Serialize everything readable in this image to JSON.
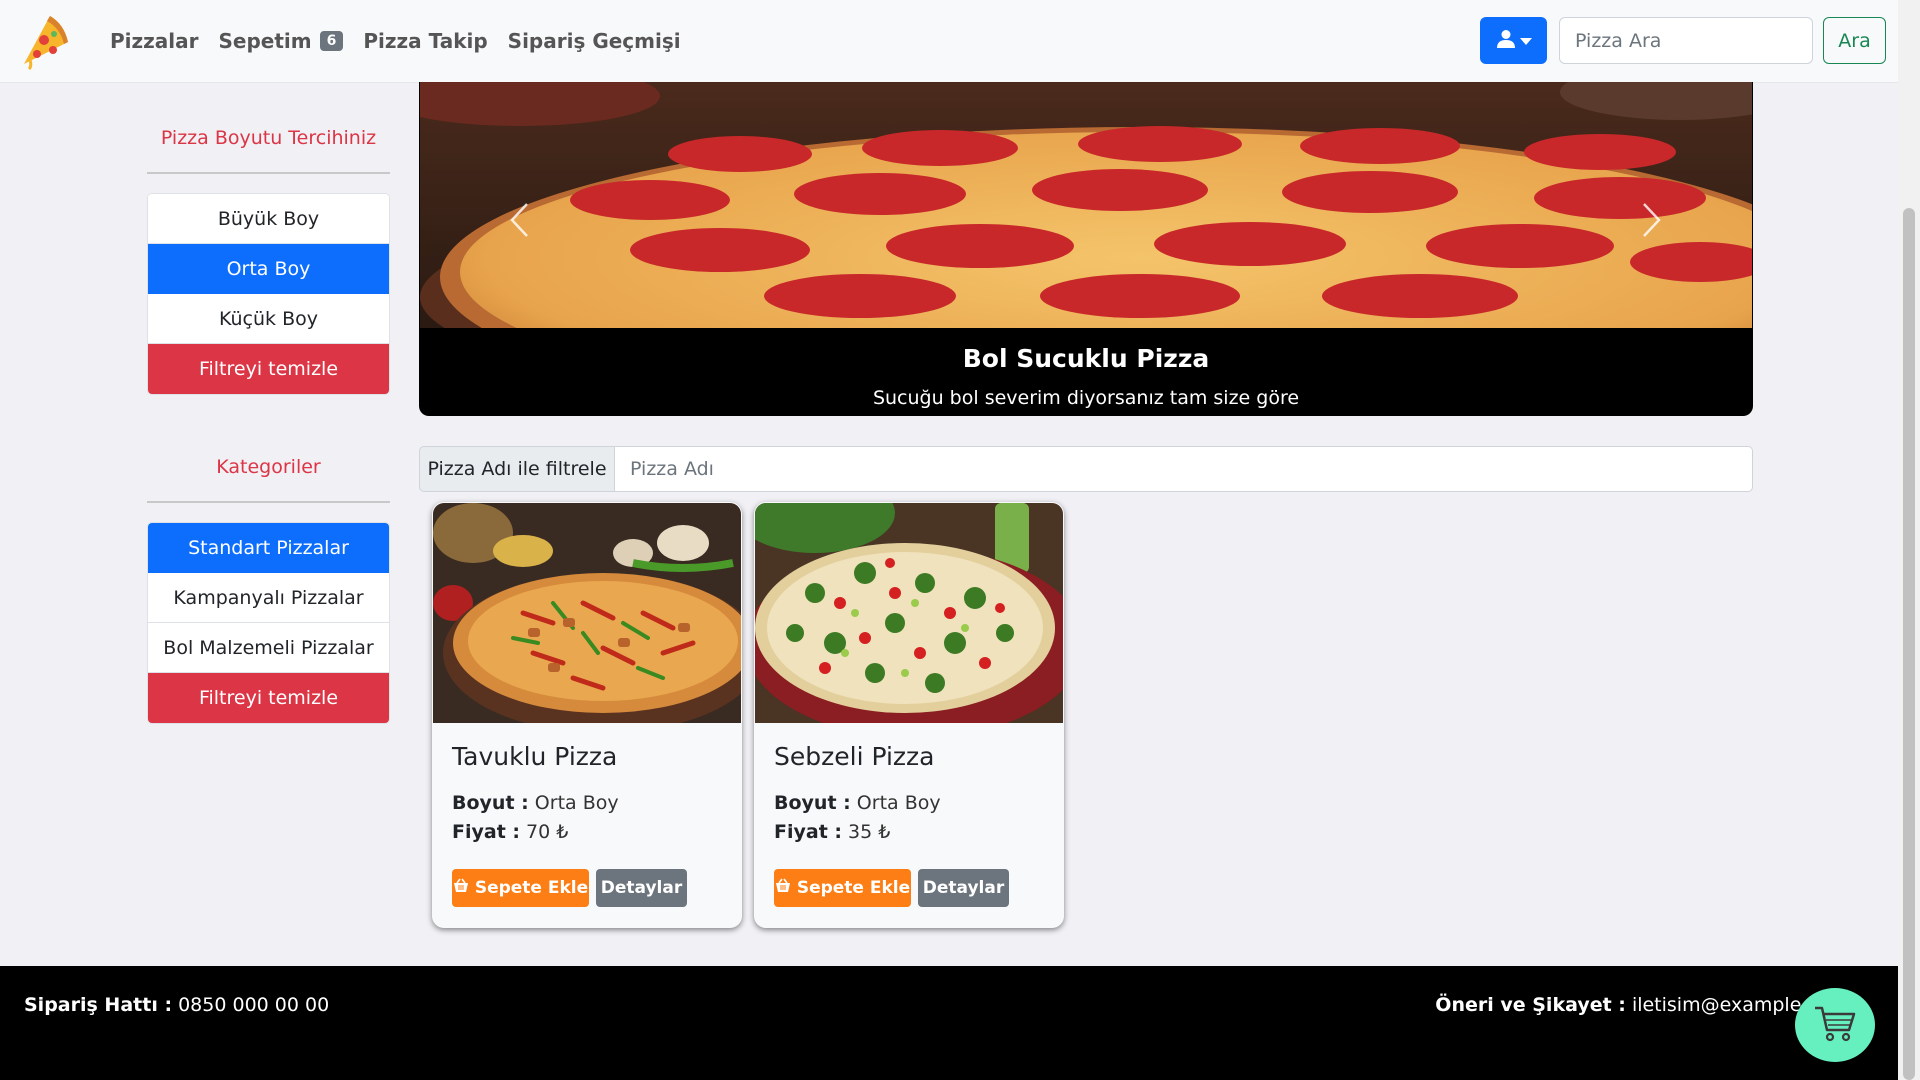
{
  "navbar": {
    "links": [
      {
        "label": "Pizzalar"
      },
      {
        "label": "Sepetim",
        "badge": "6"
      },
      {
        "label": "Pizza Takip"
      },
      {
        "label": "Sipariş Geçmişi"
      }
    ],
    "search_placeholder": "Pizza Ara",
    "search_button": "Ara"
  },
  "sidebar": {
    "size_heading": "Pizza Boyutu Tercihiniz",
    "sizes": [
      {
        "label": "Büyük Boy",
        "active": false
      },
      {
        "label": "Orta Boy",
        "active": true
      },
      {
        "label": "Küçük Boy",
        "active": false
      }
    ],
    "size_clear": "Filtreyi temizle",
    "category_heading": "Kategoriler",
    "categories": [
      {
        "label": "Standart Pizzalar",
        "active": true
      },
      {
        "label": "Kampanyalı Pizzalar",
        "active": false
      },
      {
        "label": "Bol Malzemeli Pizzalar",
        "active": false
      }
    ],
    "category_clear": "Filtreyi temizle"
  },
  "carousel": {
    "title": "Bol Sucuklu Pizza",
    "text": "Sucuğu bol severim diyorsanız tam size göre"
  },
  "filter": {
    "label": "Pizza Adı ile filtrele",
    "placeholder": "Pizza Adı"
  },
  "cards": [
    {
      "title": "Tavuklu Pizza",
      "size_label": "Boyut :",
      "size": "Orta Boy",
      "price_label": "Fiyat :",
      "price": "70 ₺",
      "cart_button": "Sepete Ekle",
      "detail_button": "Detaylar"
    },
    {
      "title": "Sebzeli Pizza",
      "size_label": "Boyut :",
      "size": "Orta Boy",
      "price_label": "Fiyat :",
      "price": "35 ₺",
      "cart_button": "Sepete Ekle",
      "detail_button": "Detaylar"
    }
  ],
  "footer": {
    "phone_label": "Sipariş Hattı :",
    "phone": "0850 000 00 00",
    "contact_label": "Öneri ve Şikayet :",
    "contact": "iletisim@example.com"
  },
  "colors": {
    "primary": "#0d6efd",
    "danger": "#dc3545",
    "warning": "#fd7e14",
    "secondary": "#6c757d",
    "success": "#198754",
    "fab": "#66f0bf"
  },
  "icons": [
    "pizza-logo-icon",
    "user-icon",
    "caret-down-icon",
    "chevron-left-icon",
    "chevron-right-icon",
    "basket-icon",
    "shopping-cart-icon"
  ]
}
